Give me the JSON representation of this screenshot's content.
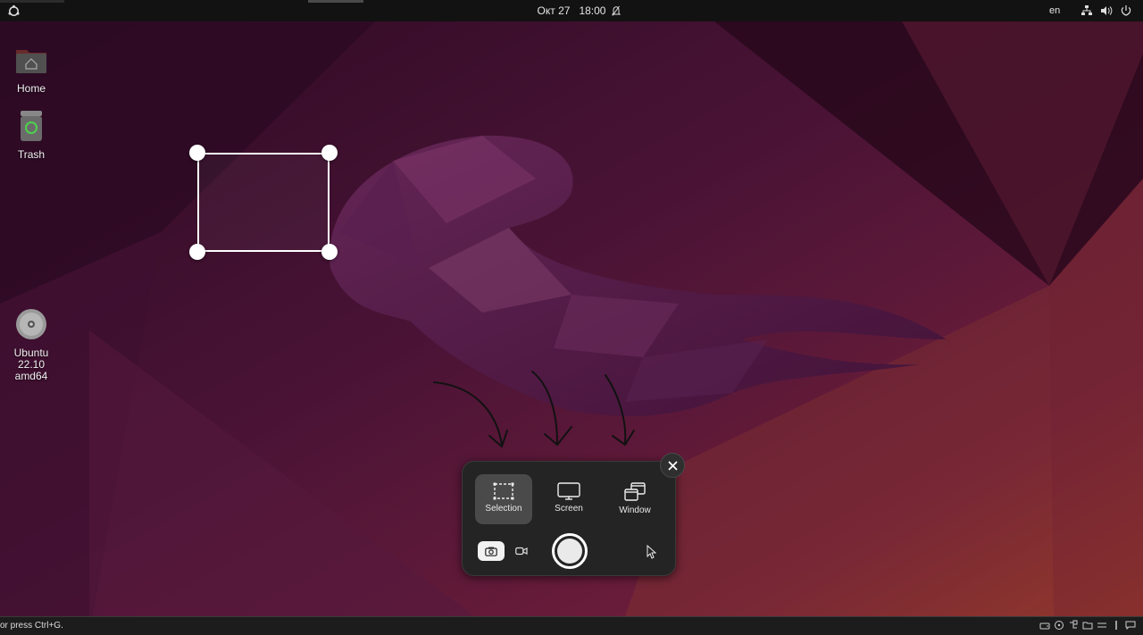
{
  "topbar": {
    "date": "Окт 27",
    "time": "18:00",
    "language": "en",
    "tray_icons": [
      "network-icon",
      "volume-icon",
      "power-icon"
    ]
  },
  "desktop_icons": [
    {
      "label": "Home",
      "icon": "home-folder-icon"
    },
    {
      "label": "Trash",
      "icon": "trash-icon"
    },
    {
      "label": "Ubuntu 22.10\namd64",
      "label_line1": "Ubuntu 22.10",
      "label_line2": "amd64",
      "icon": "disc-icon"
    }
  ],
  "screenshot_ui": {
    "modes": [
      {
        "label": "Selection",
        "icon": "selection-icon",
        "active": true
      },
      {
        "label": "Screen",
        "icon": "monitor-icon",
        "active": false
      },
      {
        "label": "Window",
        "icon": "window-icon",
        "active": false
      }
    ],
    "capture_type": "screenshot",
    "show_pointer": false
  },
  "statusbar": {
    "text": "or press Ctrl+G."
  },
  "colors": {
    "panel_bg": "#242424",
    "active_mode": "#4a4a4a",
    "topbar_bg": "#121212",
    "wallpaper_base": "#3a0d2a"
  }
}
